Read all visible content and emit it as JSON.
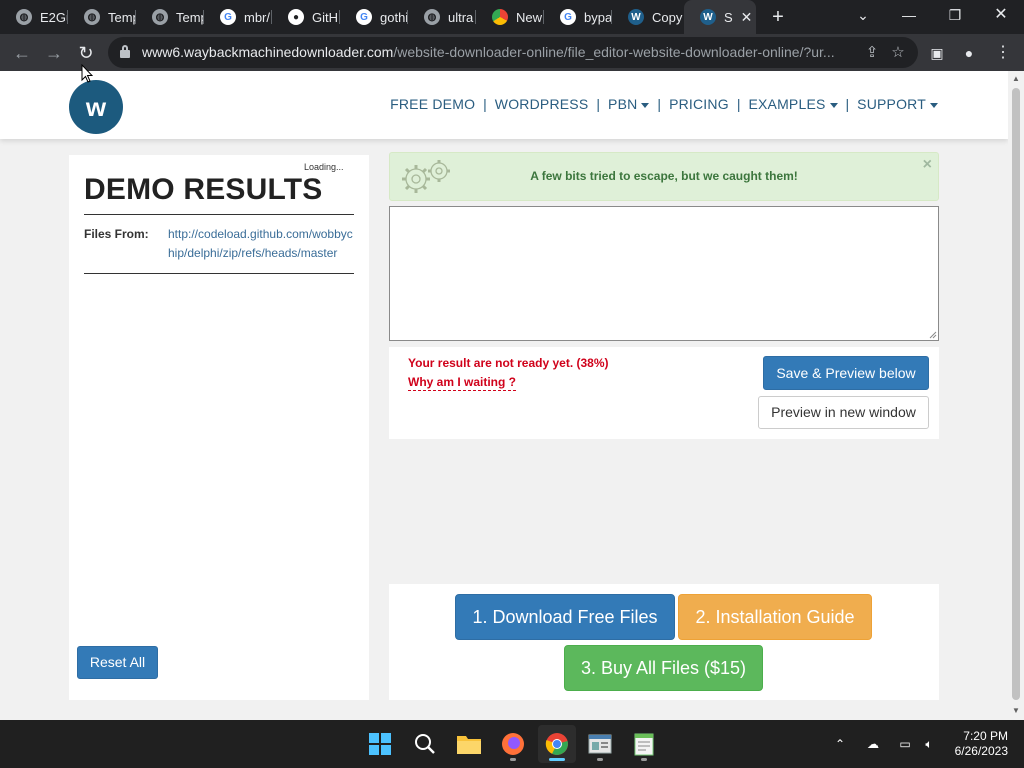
{
  "browser": {
    "tabs": [
      {
        "label": "E2Gu",
        "icon": "globe-icon"
      },
      {
        "label": "Temp",
        "icon": "globe-icon"
      },
      {
        "label": "Temp",
        "icon": "globe-icon"
      },
      {
        "label": "mbr/",
        "icon": "google-icon"
      },
      {
        "label": "GitH",
        "icon": "github-icon"
      },
      {
        "label": "gothi",
        "icon": "google-icon"
      },
      {
        "label": "ultra",
        "icon": "globe-icon"
      },
      {
        "label": "New",
        "icon": "chrome-icon"
      },
      {
        "label": "bypa",
        "icon": "google-icon"
      },
      {
        "label": "Copy",
        "icon": "w-icon"
      },
      {
        "label": "S",
        "icon": "w-icon",
        "active": true
      }
    ],
    "url_host": "www6.waybackmachinedownloader.com",
    "url_path": "/website-downloader-online/file_editor-website-downloader-online/?ur..."
  },
  "site": {
    "logo_letter": "w",
    "nav": [
      "FREE DEMO",
      "WORDPRESS",
      "PBN",
      "PRICING",
      "EXAMPLES",
      "SUPPORT"
    ],
    "loading": "Loading...",
    "demo_title": "DEMO RESULTS",
    "files_from_label": "Files From:",
    "files_from_value": "http://codeload.github.com/wobbychip/delphi/zip/refs/heads/master",
    "reset_label": "Reset All",
    "alert_text": "A few bits tried to escape, but we caught them!",
    "alert_close": "×",
    "status_text": "Your result are not ready yet. (38%)",
    "progress_percent": 38,
    "why_waiting": "Why am I waiting ?",
    "save_preview_label": "Save & Preview below",
    "preview_new_window_label": "Preview in new window",
    "download_label": "1. Download Free Files",
    "guide_label": "2. Installation Guide",
    "buy_label": "3. Buy All Files ($15)"
  },
  "taskbar": {
    "time": "7:20 PM",
    "date": "6/26/2023"
  },
  "colors": {
    "brand_blue": "#337ab7",
    "warning_orange": "#f0ad4e",
    "success_green": "#5cb85c",
    "error_red": "#d0021b",
    "nav_blue": "#2a5d80"
  }
}
